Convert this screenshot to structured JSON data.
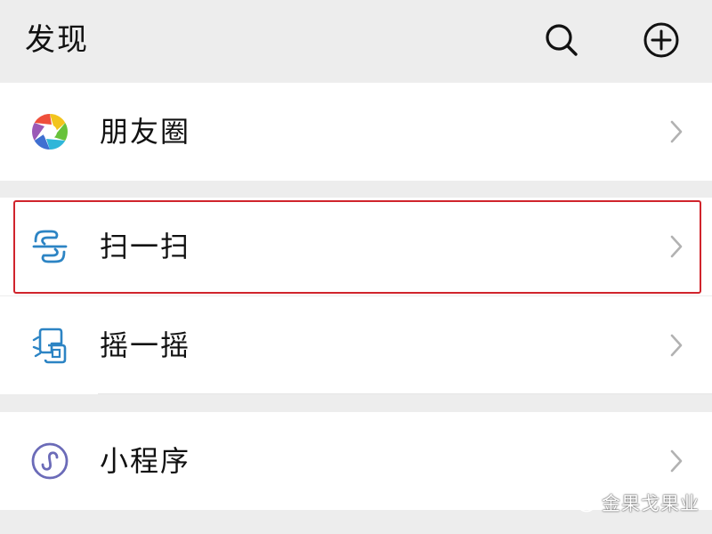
{
  "header": {
    "title": "发现",
    "search_icon": "search-icon",
    "add_icon": "plus-circle-icon"
  },
  "menu": {
    "items": [
      {
        "label": "朋友圈",
        "icon": "moments-aperture-icon"
      },
      {
        "label": "扫一扫",
        "icon": "scan-icon",
        "highlighted": true
      },
      {
        "label": "摇一摇",
        "icon": "shake-icon"
      },
      {
        "label": "小程序",
        "icon": "mini-program-icon"
      }
    ]
  },
  "watermark": {
    "text": "金果戈果业",
    "icon": "wechat-official-account-icon"
  },
  "colors": {
    "background": "#ededed",
    "row_background": "#ffffff",
    "text": "#111111",
    "chevron": "#b2b2b2",
    "scan_icon": "#2c84c4",
    "shake_icon": "#2c84c4",
    "mini_program_icon": "#6b6bb8",
    "highlight_border": "#d0242c"
  }
}
